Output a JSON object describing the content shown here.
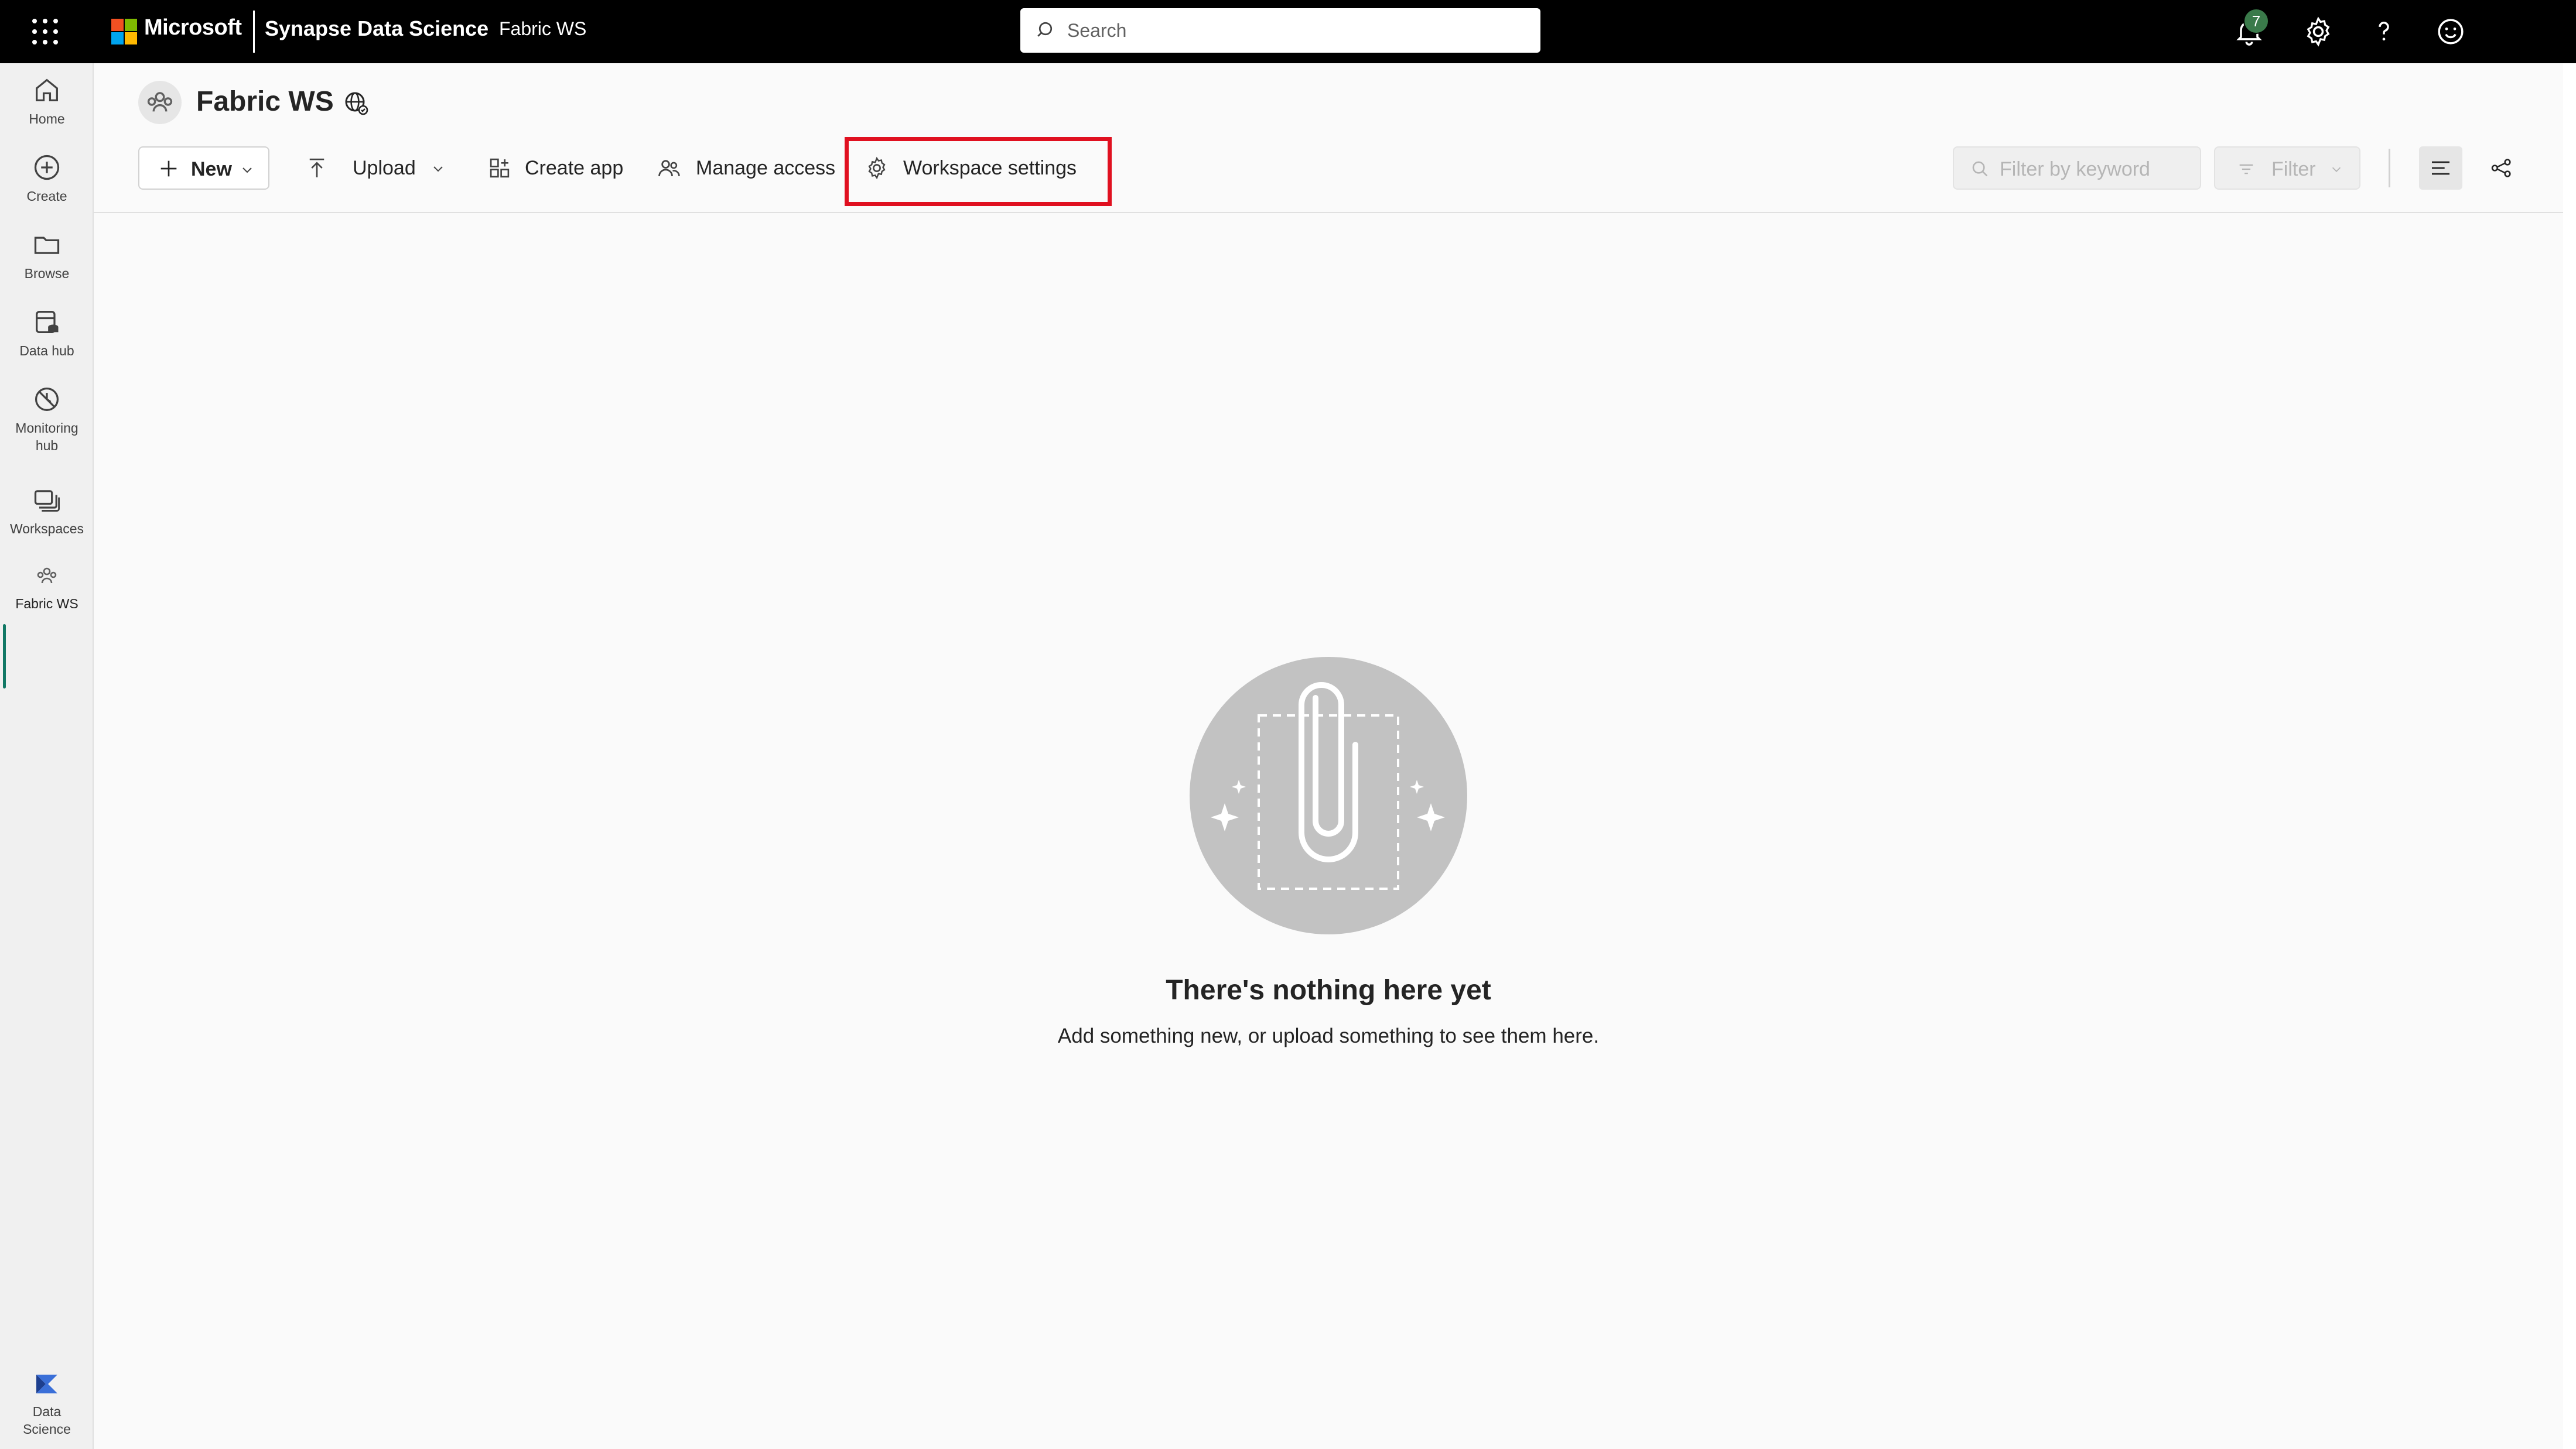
{
  "topbar": {
    "brand": "Microsoft",
    "app_name": "Synapse Data Science",
    "workspace": "Fabric WS",
    "search_placeholder": "Search",
    "notification_count": "7",
    "icons": [
      "waffle-icon",
      "bell-icon",
      "gear-icon",
      "help-icon",
      "feedback-icon"
    ]
  },
  "rail": {
    "items": [
      {
        "label": "Home",
        "icon": "home-icon"
      },
      {
        "label": "Create",
        "icon": "create-icon"
      },
      {
        "label": "Browse",
        "icon": "folder-icon"
      },
      {
        "label": "Data hub",
        "icon": "data-hub-icon"
      },
      {
        "label": "Monitoring hub",
        "icon": "monitor-icon"
      },
      {
        "label": "Workspaces",
        "icon": "workspaces-icon"
      },
      {
        "label": "Fabric WS",
        "icon": "workspace-people-icon"
      }
    ],
    "bottom": {
      "label": "Data Science",
      "icon": "data-science-icon"
    }
  },
  "header": {
    "title": "Fabric WS"
  },
  "toolbar": {
    "new_label": "New",
    "upload_label": "Upload",
    "create_app_label": "Create app",
    "manage_access_label": "Manage access",
    "workspace_settings_label": "Workspace settings",
    "filter_placeholder": "Filter by keyword",
    "filter_label": "Filter"
  },
  "empty_state": {
    "title": "There's nothing here yet",
    "subtitle": "Add something new, or upload something to see them here."
  },
  "colors": {
    "accent": "#117865",
    "highlight": "#e01020"
  }
}
